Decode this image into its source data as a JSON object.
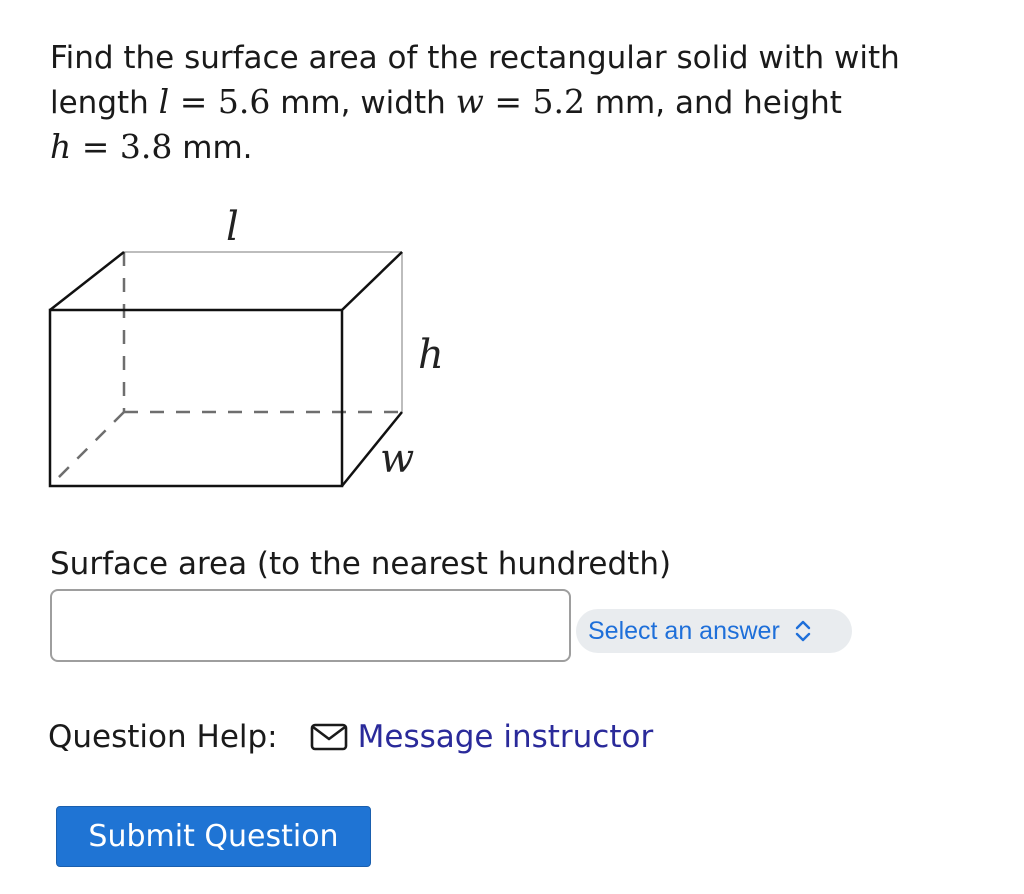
{
  "question": {
    "line1": "Find the surface area of the rectangular solid with with",
    "length_word": "length ",
    "l_var": "l",
    "l_eq": " = 5.6",
    "l_unit": " mm, width ",
    "w_var": "w",
    "w_eq": " = 5.2",
    "w_unit": " mm, and height",
    "h_var": "h",
    "h_eq": " = 3.8",
    "h_unit": " mm."
  },
  "figure": {
    "label_length": "l",
    "label_height": "h",
    "label_width": "w"
  },
  "answer": {
    "label": "Surface area (to the nearest hundredth)",
    "input_value": "",
    "unit_select": "Select an answer"
  },
  "help": {
    "label": "Question Help:",
    "message_link": "Message instructor"
  },
  "submit_label": "Submit Question"
}
